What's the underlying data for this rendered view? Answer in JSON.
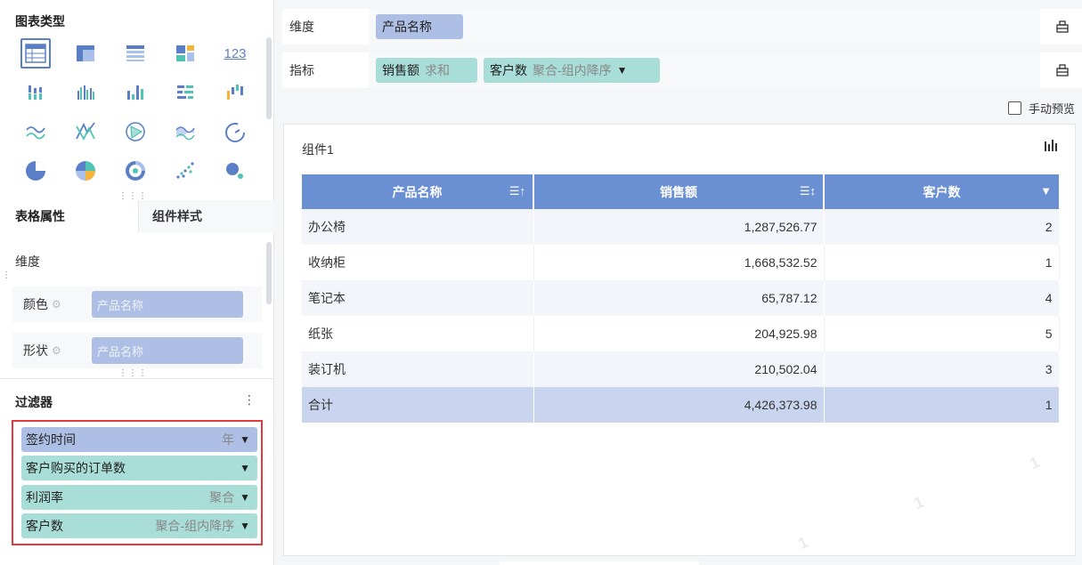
{
  "left": {
    "chart_types_title": "图表类型",
    "chart_types": [
      [
        "table-icon",
        "cross-table-icon",
        "detail-table-icon",
        "block-icon",
        "text-icon"
      ],
      [
        "stack-bar-icon",
        "group-bar-icon",
        "column-icon",
        "horizontal-bar-icon",
        "waterfall-icon"
      ],
      [
        "line-icon",
        "radar-icon",
        "polar-icon",
        "area-icon",
        "gauge-icon"
      ],
      [
        "pie-icon",
        "rose-pie-icon",
        "donut-icon",
        "scatter-icon",
        "bubble-icon"
      ]
    ],
    "text_icon_glyph": "123",
    "tabs": [
      "表格属性",
      "组件样式"
    ],
    "dimension_label": "维度",
    "props": [
      {
        "label": "颜色",
        "value": "产品名称"
      },
      {
        "label": "形状",
        "value": "产品名称"
      }
    ],
    "filter_title": "过滤器",
    "filter_menu": "⋮",
    "filters": [
      {
        "label": "签约时间",
        "sub": "年",
        "color": "#aebfe6"
      },
      {
        "label": "客户购买的订单数",
        "sub": "",
        "color": "#a9ddd7"
      },
      {
        "label": "利润率",
        "sub": "聚合",
        "color": "#a9ddd7"
      },
      {
        "label": "客户数",
        "sub": "聚合-组内降序",
        "color": "#a9ddd7"
      }
    ]
  },
  "right": {
    "dimension": {
      "label": "维度",
      "pill": "产品名称"
    },
    "metric": {
      "label": "指标",
      "pills": [
        {
          "name": "销售额",
          "sub": "求和"
        },
        {
          "name": "客户数",
          "sub": "聚合-组内降序"
        }
      ]
    },
    "manual_preview": "手动预览",
    "widget_title": "组件1",
    "table": {
      "headers": [
        "产品名称",
        "销售额",
        "客户数"
      ],
      "rows": [
        [
          "办公椅",
          "1,287,526.77",
          "2"
        ],
        [
          "收纳柜",
          "1,668,532.52",
          "1"
        ],
        [
          "笔记本",
          "65,787.12",
          "4"
        ],
        [
          "纸张",
          "204,925.98",
          "5"
        ],
        [
          "装订机",
          "210,502.04",
          "3"
        ]
      ],
      "total": [
        "合计",
        "4,426,373.98",
        "1"
      ]
    },
    "watermark": "1"
  },
  "colors": {
    "dimension_pill": "#aebfe6",
    "metric_pill": "#a9ddd7",
    "table_header": "#6b8fd3",
    "highlight_border": "#e23b3b"
  }
}
